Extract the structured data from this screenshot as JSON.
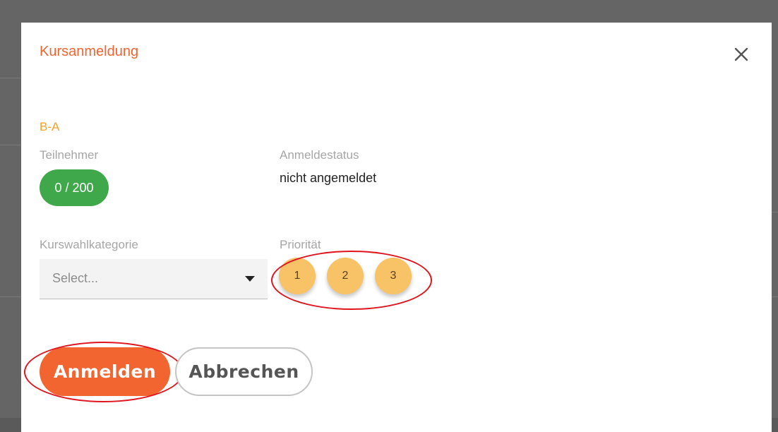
{
  "dialog": {
    "title": "Kursanmeldung",
    "close_icon": "close-icon",
    "course_code": "B-A",
    "participants_label": "Teilnehmer",
    "participants_count": "0 / 200",
    "status_label": "Anmeldestatus",
    "status_value": "nicht angemeldet",
    "category_label": "Kurswahlkategorie",
    "category_placeholder": "Select...",
    "priority_label": "Priorität",
    "priorities": [
      "1",
      "2",
      "3"
    ],
    "submit_label": "Anmelden",
    "cancel_label": "Abbrechen"
  },
  "colors": {
    "accent": "#f26430",
    "course_code": "#f2a22a",
    "count_pill": "#3fa84b",
    "priority": "#f8c266",
    "highlight": "#e0141e"
  }
}
